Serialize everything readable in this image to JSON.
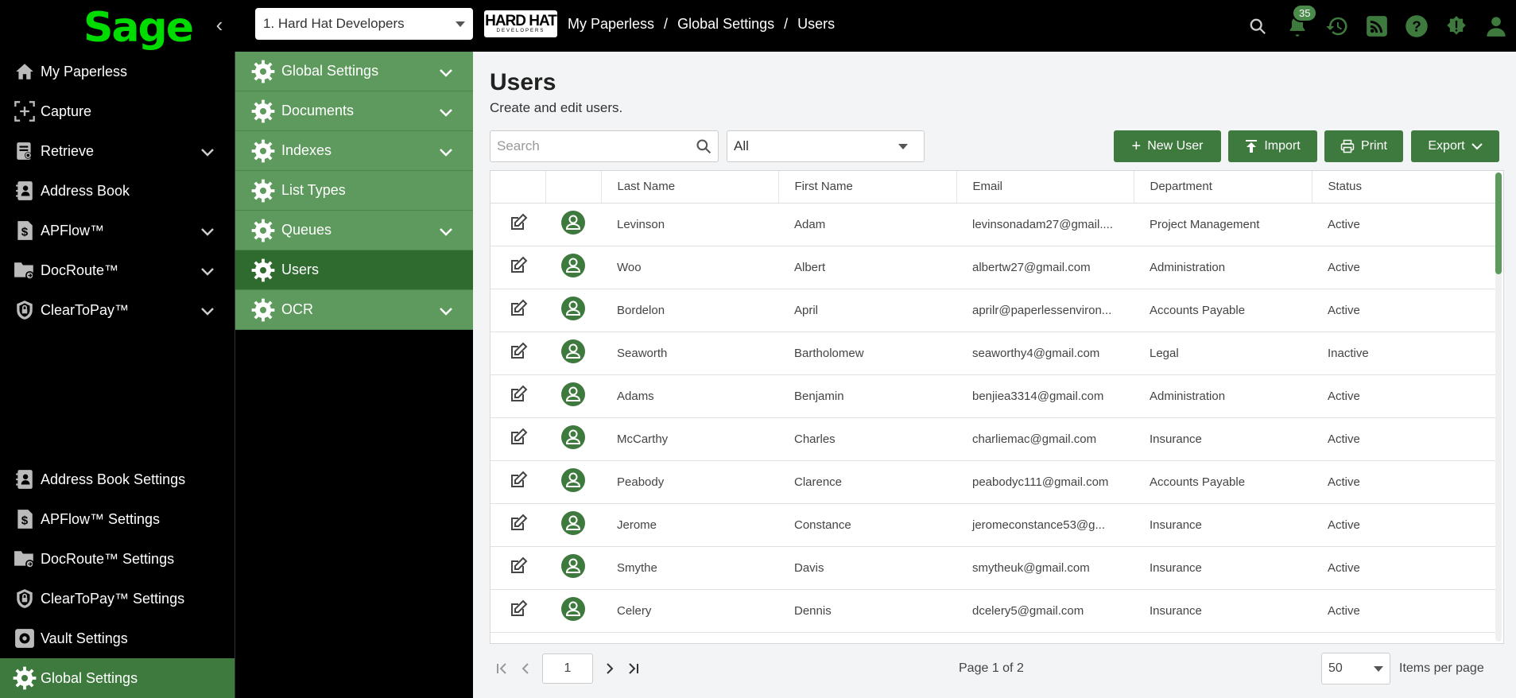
{
  "header": {
    "logo": "Sage",
    "company": "1. Hard Hat Developers",
    "company_logo_big": "HARD HAT",
    "company_logo_small": "DEVELOPERS",
    "breadcrumb": [
      "My Paperless",
      "Global Settings",
      "Users"
    ],
    "notification_count": "35",
    "icons": [
      "search-icon",
      "bell-icon",
      "history-icon",
      "rss-icon",
      "help-icon",
      "alert-icon",
      "user-icon"
    ]
  },
  "sidebar": {
    "top_items": [
      {
        "label": "My Paperless",
        "icon": "home-icon",
        "expandable": false
      },
      {
        "label": "Capture",
        "icon": "capture-icon",
        "expandable": false
      },
      {
        "label": "Retrieve",
        "icon": "retrieve-icon",
        "expandable": true
      },
      {
        "label": "Address Book",
        "icon": "address-book-icon",
        "expandable": false
      },
      {
        "label": "APFlow™",
        "icon": "apflow-icon",
        "expandable": true
      },
      {
        "label": "DocRoute™",
        "icon": "docroute-icon",
        "expandable": true
      },
      {
        "label": "ClearToPay™",
        "icon": "cleartopay-icon",
        "expandable": true
      }
    ],
    "bottom_items": [
      {
        "label": "Address Book Settings",
        "icon": "address-book-icon"
      },
      {
        "label": "APFlow™ Settings",
        "icon": "apflow-icon"
      },
      {
        "label": "DocRoute™ Settings",
        "icon": "docroute-icon"
      },
      {
        "label": "ClearToPay™ Settings",
        "icon": "cleartopay-icon"
      },
      {
        "label": "Vault Settings",
        "icon": "vault-gear-icon"
      },
      {
        "label": "Global Settings",
        "icon": "gear-icon",
        "active": true
      }
    ]
  },
  "submenu": {
    "items": [
      {
        "label": "Global Settings",
        "expandable": true
      },
      {
        "label": "Documents",
        "expandable": true
      },
      {
        "label": "Indexes",
        "expandable": true
      },
      {
        "label": "List Types",
        "expandable": false
      },
      {
        "label": "Queues",
        "expandable": true
      },
      {
        "label": "Users",
        "expandable": false,
        "active": true
      },
      {
        "label": "OCR",
        "expandable": true
      }
    ]
  },
  "main": {
    "title": "Users",
    "subtitle": "Create and edit users.",
    "search_placeholder": "Search",
    "filter_value": "All",
    "buttons": {
      "new_user": "New User",
      "import": "Import",
      "print": "Print",
      "export": "Export"
    },
    "columns": [
      "Last Name",
      "First Name",
      "Email",
      "Department",
      "Status"
    ],
    "rows": [
      [
        "Levinson",
        "Adam",
        "levinsonadam27@gmail....",
        "Project Management",
        "Active"
      ],
      [
        "Woo",
        "Albert",
        "albertw27@gmail.com",
        "Administration",
        "Active"
      ],
      [
        "Bordelon",
        "April",
        "aprilr@paperlessenviron...",
        "Accounts Payable",
        "Active"
      ],
      [
        "Seaworth",
        "Bartholomew",
        "seaworthy4@gmail.com",
        "Legal",
        "Inactive"
      ],
      [
        "Adams",
        "Benjamin",
        "benjiea3314@gmail.com",
        "Administration",
        "Active"
      ],
      [
        "McCarthy",
        "Charles",
        "charliemac@gmail.com",
        "Insurance",
        "Active"
      ],
      [
        "Peabody",
        "Clarence",
        "peabodyc111@gmail.com",
        "Accounts Payable",
        "Active"
      ],
      [
        "Jerome",
        "Constance",
        "jeromeconstance53@g...",
        "Insurance",
        "Active"
      ],
      [
        "Smythe",
        "Davis",
        "smytheuk@gmail.com",
        "Insurance",
        "Active"
      ],
      [
        "Celery",
        "Dennis",
        "dcelery5@gmail.com",
        "Insurance",
        "Active"
      ]
    ],
    "pager": {
      "page_input": "1",
      "page_text": "Page 1 of 2",
      "page_size": "50",
      "page_size_label": "Items per page"
    }
  },
  "colors": {
    "brand_green": "#00dc00",
    "accent": "#3e7a3e",
    "submenu": "#5e9a5e",
    "submenu_active": "#2f6b2f"
  }
}
